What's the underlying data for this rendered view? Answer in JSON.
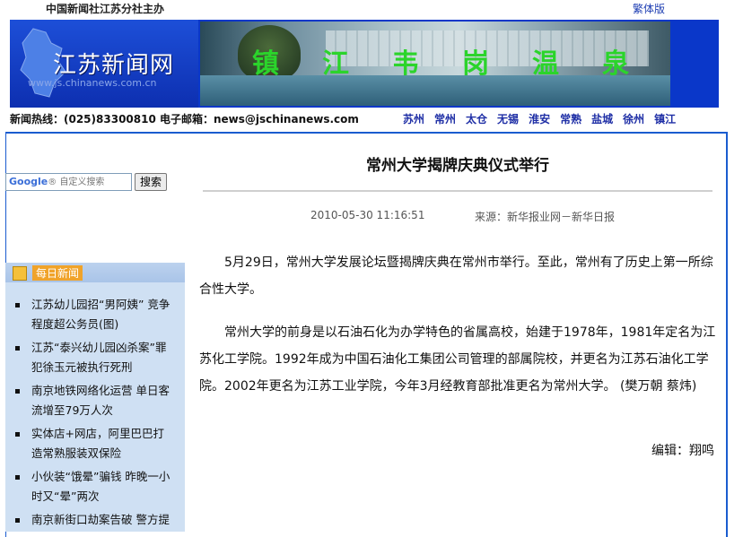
{
  "topbar": {
    "org": "中国新闻社江苏分社主办",
    "traditional": "繁体版"
  },
  "banner": {
    "site_name": "江苏新闻网",
    "site_url": "www.js.chinanews.com.cn",
    "ad_chars": [
      "镇",
      "江",
      "韦",
      "岗",
      "温",
      "泉"
    ]
  },
  "hotline": {
    "text": "新闻热线：(025)83300810 电子邮箱：news@jschinanews.com",
    "cities": [
      "苏州",
      "常州",
      "太仓",
      "无锡",
      "淮安",
      "常熟",
      "盐城",
      "徐州",
      "镇江"
    ]
  },
  "search": {
    "placeholder": "自定义搜索",
    "button": "搜索"
  },
  "daily_news": {
    "title": "每日新闻",
    "items": [
      "江苏幼儿园招“男阿姨” 竞争程度超公务员(图)",
      "江苏“泰兴幼儿园凶杀案”罪犯徐玉元被执行死刑",
      "南京地铁网络化运营 单日客流增至79万人次",
      "实体店+网店，阿里巴巴打造常熟服装双保险",
      "小伙装“饿晕”骗钱 昨晚一小时又“晕”两次",
      "南京新街口劫案告破 警方提"
    ]
  },
  "article": {
    "title": "常州大学揭牌庆典仪式举行",
    "date": "2010-05-30 11:16:51",
    "source": "来源：新华报业网－新华日报",
    "paragraphs": [
      "5月29日，常州大学发展论坛暨揭牌庆典在常州市举行。至此，常州有了历史上第一所综合性大学。",
      "常州大学的前身是以石油石化为办学特色的省属高校，始建于1978年，1981年定名为江苏化工学院。1992年成为中国石油化工集团公司管理的部属院校，并更名为江苏石油化工学院。2002年更名为江苏工业学院，今年3月经教育部批准更名为常州大学。 (樊万朝 蔡炜)"
    ],
    "editor": "编辑：翔鸣"
  },
  "colors": {
    "brand_blue": "#0a37c9",
    "frame_blue": "#1a5ccf",
    "sidebar_bg": "#cfe0f3",
    "ad_text": "#2bd42b"
  }
}
